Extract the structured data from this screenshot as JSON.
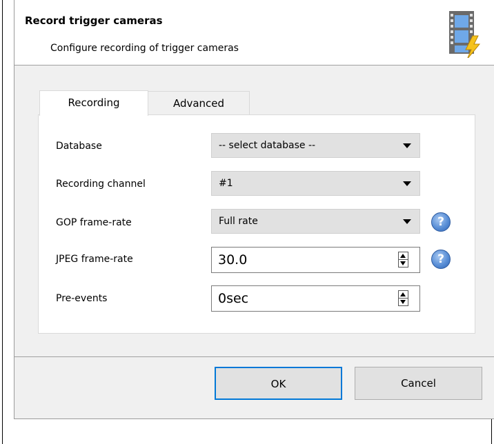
{
  "header": {
    "title": "Record trigger cameras",
    "subtitle": "Configure recording of trigger cameras",
    "icon": "film-lightning-icon"
  },
  "tabs": [
    {
      "label": "Recording",
      "selected": true
    },
    {
      "label": "Advanced",
      "selected": false
    }
  ],
  "fields": {
    "database": {
      "label": "Database",
      "value": "-- select database --"
    },
    "recording_channel": {
      "label": "Recording channel",
      "value": "#1"
    },
    "gop_frame_rate": {
      "label": "GOP frame-rate",
      "value": "Full rate",
      "help_icon": "?"
    },
    "jpeg_frame_rate": {
      "label": "JPEG frame-rate",
      "value": "30.0",
      "help_icon": "?"
    },
    "pre_events": {
      "label": "Pre-events",
      "value": "0sec"
    }
  },
  "buttons": {
    "ok": "OK",
    "cancel": "Cancel"
  },
  "colors": {
    "accent": "#0078d7",
    "help_icon": "#5a8fd6"
  }
}
